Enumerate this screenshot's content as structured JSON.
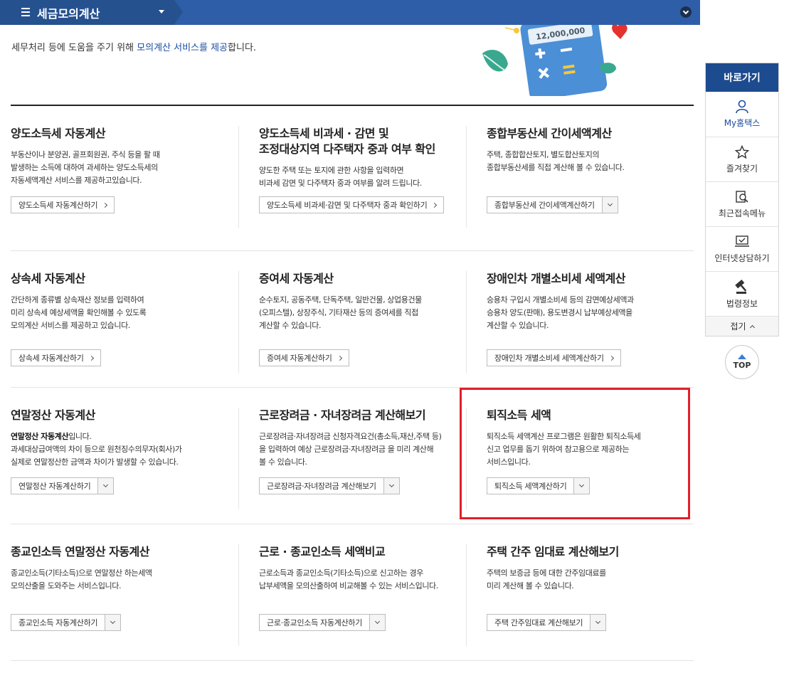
{
  "header": {
    "menu_title": "세금모의계산"
  },
  "intro": {
    "prefix": "세무처리 등에 도움을 주기 위해 ",
    "highlight": "모의계산 서비스를 제공",
    "suffix": "합니다."
  },
  "illustration": {
    "amount": "12,000,000"
  },
  "services": [
    {
      "title": "양도소득세 자동계산",
      "desc": [
        "부동산이나 분양권, 골프회원권, 주식 등을 팔 때",
        "발생하는 소득에 대하여 과세하는 양도소득세의",
        "자동세액계산 서비스를 제공하고있습니다."
      ],
      "button": "양도소득세 자동계산하기",
      "type": "link"
    },
    {
      "title": "양도소득세 비과세 · 감면 및",
      "title2": "조정대상지역 다주택자 중과 여부 확인",
      "desc": [
        "양도한 주택 또는 토지에 관한 사항을 입력하면",
        "비과세 감면 및 다주택자 중과 여부를 알려 드립니다."
      ],
      "button": "양도소득세 비과세·감면 및 다주택자 중과 확인하기",
      "type": "link"
    },
    {
      "title": "종합부동산세 간이세액계산",
      "desc": [
        "주택, 종합합산토지, 별도합산토지의",
        "종합부동산세를 직접 계산해 볼 수 있습니다."
      ],
      "button": "종합부동산세 간이세액계산하기",
      "type": "select"
    },
    {
      "title": "상속세 자동계산",
      "desc": [
        "간단하게 종류별 상속재산 정보를 입력하여",
        "미리 상속세 예상세액을 확인해볼 수 있도록",
        "모의계산 서비스를 제공하고 있습니다."
      ],
      "button": "상속세 자동계산하기",
      "type": "link"
    },
    {
      "title": "증여세 자동계산",
      "desc": [
        "순수토지, 공동주택, 단독주택, 일반건물, 상업용건물",
        "(오피스텔), 상장주식, 기타재산 등의 증여세를 직접",
        "계산할 수 있습니다."
      ],
      "button": "증여세 자동계산하기",
      "type": "link"
    },
    {
      "title": "장애인차 개별소비세 세액계산",
      "desc": [
        "승용차 구입시 개별소비세 등의 감면예상세액과",
        "승용차 양도(판매), 용도변경시 납부예상세액을",
        "계산할 수 있습니다."
      ],
      "button": "장애인차 개별소비세 세액계산하기",
      "type": "link"
    },
    {
      "title": "연말정산 자동계산",
      "desc_bold": "연말정산 자동계산",
      "desc_bold_suffix": "입니다.",
      "desc": [
        "과세대상급여액의 차이 등으로 원천징수의무자(회사)가",
        "실제로 연말정산한 금액과 차이가 발생할 수 있습니다."
      ],
      "button": "연말정산 자동계산하기",
      "type": "select"
    },
    {
      "title": "근로장려금 · 자녀장려금 계산해보기",
      "desc": [
        "근로장려금·자녀장려금 신청자격요건(총소득,재산,주택 등)",
        "을 입력하여 예상 근로장려금·자녀장려금 을 미리 계산해",
        "볼 수 있습니다."
      ],
      "button": "근로장려금·자녀장려금 계산해보기",
      "type": "select"
    },
    {
      "title": "퇴직소득 세액",
      "desc": [
        "퇴직소득 세액계산 프로그램은 원활한 퇴직소득세",
        "신고 업무를 돕기 위하여 참고용으로 제공하는",
        "서비스입니다."
      ],
      "button": "퇴직소득 세액계산하기",
      "type": "select"
    },
    {
      "title": "종교인소득 연말정산 자동계산",
      "desc": [
        "종교인소득(기타소득)으로 연말정산 하는세액",
        "모의산출을 도와주는 서비스입니다."
      ],
      "button": "종교인소득 자동계산하기",
      "type": "select"
    },
    {
      "title": "근로 · 종교인소득 세액비교",
      "desc": [
        "근로소득과 종교인소득(기타소득)으로 신고하는 경우",
        "납부세액을 모의산출하여 비교해볼 수 있는 서비스입니다."
      ],
      "button": "근로·종교인소득 자동계산하기",
      "type": "select"
    },
    {
      "title": "주택 간주 임대료 계산해보기",
      "desc": [
        "주택의 보증금 등에 대한 간주임대료를",
        "미리 계산해 볼 수 있습니다."
      ],
      "button": "주택 간주임대료 계산해보기",
      "type": "select"
    }
  ],
  "quick": {
    "title": "바로가기",
    "items": [
      "My홈택스",
      "즐겨찾기",
      "최근접속메뉴",
      "인터넷상담하기",
      "법령정보"
    ],
    "fold": "접기",
    "top": "TOP"
  }
}
